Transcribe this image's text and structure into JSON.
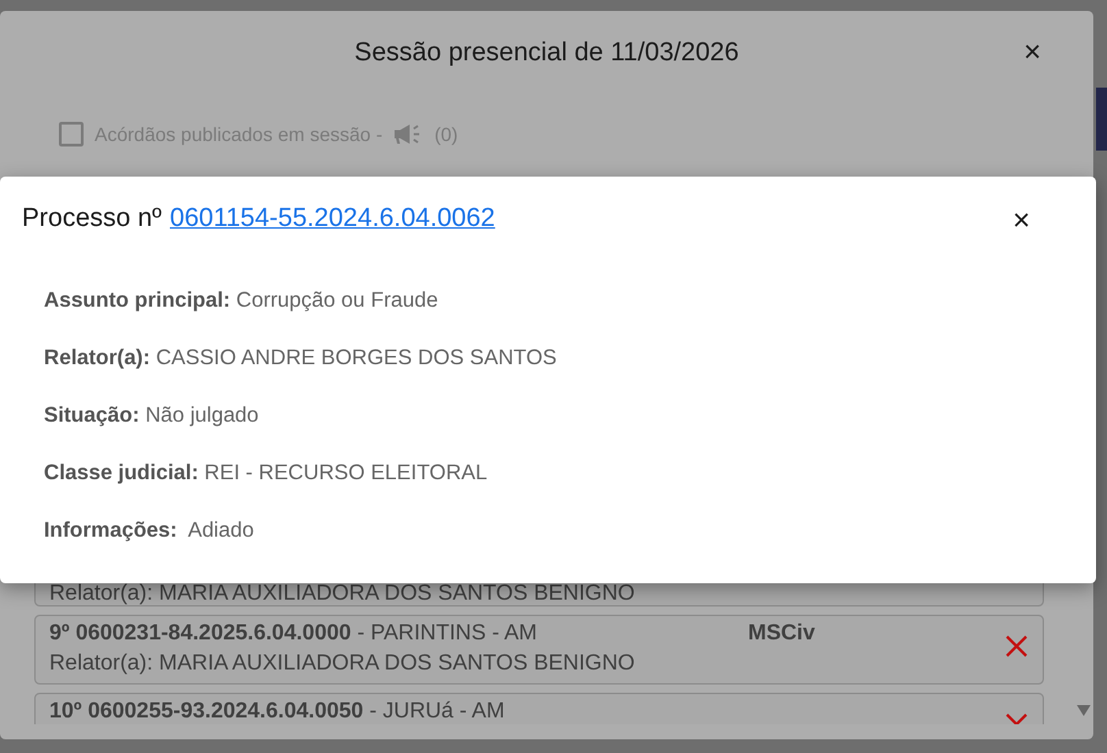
{
  "session_dialog": {
    "title": "Sessão presencial de 11/03/2026",
    "close": "×",
    "published_filter": {
      "label": "Acórdãos publicados em sessão -",
      "count": "(0)",
      "checked": false
    },
    "cards": [
      {
        "relator": "Relator(a): MARIA AUXILIADORA DOS SANTOS BENIGNO",
        "removable": false
      },
      {
        "heading": "**9º 0600231-84.2025.6.04.0000** - PARINTINS - AM",
        "relator": "Relator(a): MARIA AUXILIADORA DOS SANTOS BENIGNO",
        "class_code": "MSCiv",
        "removable": true
      },
      {
        "heading": "**10º 0600255-93.2024.6.04.0050** - JURUá - AM",
        "removable": true
      }
    ]
  },
  "process_dialog": {
    "title": "Processo nº",
    "process_link": "0601154-55.2024.6.04.0062",
    "close": "×",
    "fields": [
      {
        "text": "**Assunto principal:** Corrupção ou Fraude"
      },
      {
        "text": "**Relator(a):** CASSIO ANDRE BORGES DOS SANTOS"
      },
      {
        "text": "**Situação:** Não julgado"
      },
      {
        "text": "**Classe judicial:** REI - RECURSO ELEITORAL"
      },
      {
        "text": "**Informações:**  Adiado"
      }
    ]
  }
}
